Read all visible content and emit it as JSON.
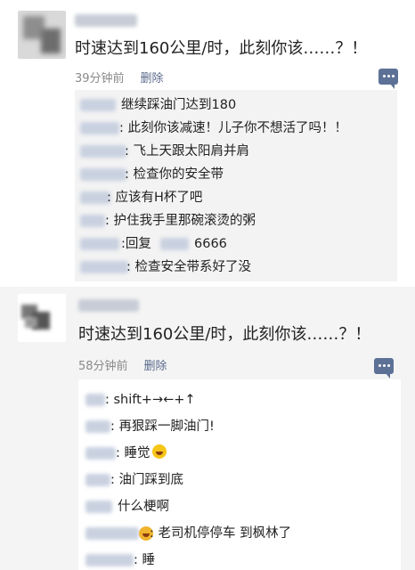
{
  "posts": [
    {
      "text": "时速达到160公里/时，此刻你该……？！",
      "time": "39分钟前",
      "delete_label": "删除",
      "replies": [
        {
          "text": "继续踩油门达到180"
        },
        {
          "text": ": 此刻你该减速！儿子你不想活了吗！！"
        },
        {
          "text": ": 飞上天跟太阳肩并肩"
        },
        {
          "text": ": 检查你的安全带"
        },
        {
          "text": ": 应该有H杯了吧"
        },
        {
          "text": ": 护住我手里那碗滚烫的粥"
        },
        {
          "text": ":回复",
          "extra": "6666"
        },
        {
          "text": ": 检查安全带系好了没"
        }
      ]
    },
    {
      "text": "时速达到160公里/时，此刻你该……？！",
      "time": "58分钟前",
      "delete_label": "删除",
      "replies": [
        {
          "text": ": shift+→←+↑"
        },
        {
          "text": ": 再狠踩一脚油门!"
        },
        {
          "text": ": 睡觉"
        },
        {
          "text": ": 油门踩到底"
        },
        {
          "text": "什么梗啊"
        },
        {
          "text": ": 老司机停停车  到枫林了"
        },
        {
          "text": ": 睡"
        }
      ]
    }
  ],
  "icons": {
    "comment": "comment-bubble-icon",
    "emoji": "laughing-emoji-icon"
  },
  "colors": {
    "delete_link": "#5b6a8c",
    "icon": "#5d7196",
    "meta": "#8a8a8a"
  }
}
